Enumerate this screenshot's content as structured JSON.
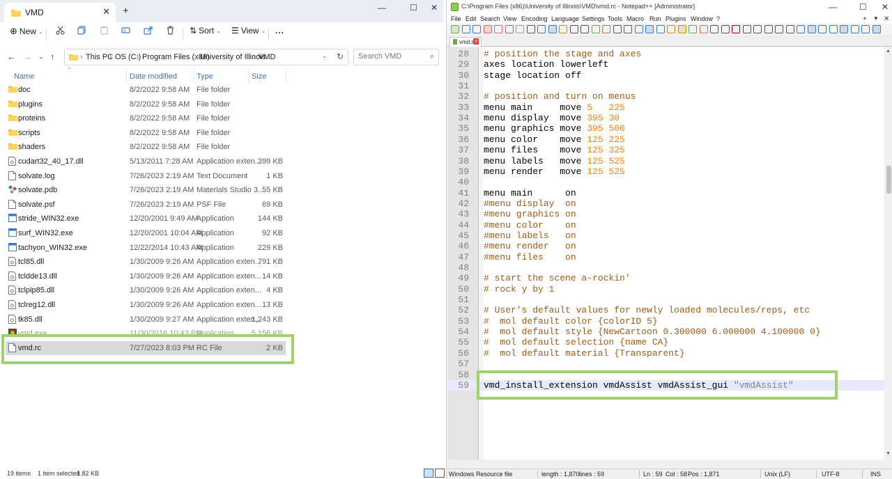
{
  "explorer": {
    "tab_title": "VMD",
    "new_tab": "+",
    "window_controls": {
      "minimize": "—",
      "maximize": "☐",
      "close": "✕"
    },
    "toolbar": {
      "new_label": "New",
      "sort_label": "Sort",
      "view_label": "View",
      "more_label": "..."
    },
    "breadcrumbs": [
      "This PC",
      "OS (C:)",
      "Program Files (x86)",
      "University of Illinois",
      "VMD"
    ],
    "search_placeholder": "Search VMD",
    "columns": {
      "name": "Name",
      "date": "Date modified",
      "type": "Type",
      "size": "Size"
    },
    "files": [
      {
        "name": "doc",
        "date": "8/2/2022 9:58 AM",
        "type": "File folder",
        "size": "",
        "icon": "folder-icon"
      },
      {
        "name": "plugins",
        "date": "8/2/2022 9:58 AM",
        "type": "File folder",
        "size": "",
        "icon": "folder-icon"
      },
      {
        "name": "proteins",
        "date": "8/2/2022 9:58 AM",
        "type": "File folder",
        "size": "",
        "icon": "folder-icon"
      },
      {
        "name": "scripts",
        "date": "8/2/2022 9:58 AM",
        "type": "File folder",
        "size": "",
        "icon": "folder-icon"
      },
      {
        "name": "shaders",
        "date": "8/2/2022 9:58 AM",
        "type": "File folder",
        "size": "",
        "icon": "folder-icon"
      },
      {
        "name": "cudart32_40_17.dll",
        "date": "5/13/2011 7:28 AM",
        "type": "Application exten...",
        "size": "399 KB",
        "icon": "dll-icon"
      },
      {
        "name": "solvate.log",
        "date": "7/26/2023 2:19 AM",
        "type": "Text Document",
        "size": "1 KB",
        "icon": "document-icon"
      },
      {
        "name": "solvate.pdb",
        "date": "7/26/2023 2:19 AM",
        "type": "Materials Studio 3...",
        "size": "55 KB",
        "icon": "pdb-icon"
      },
      {
        "name": "solvate.psf",
        "date": "7/26/2023 2:19 AM",
        "type": "PSF File",
        "size": "69 KB",
        "icon": "document-icon"
      },
      {
        "name": "stride_WIN32.exe",
        "date": "12/20/2001 9:49 AM",
        "type": "Application",
        "size": "144 KB",
        "icon": "application-icon"
      },
      {
        "name": "surf_WIN32.exe",
        "date": "12/20/2001 10:04 AM",
        "type": "Application",
        "size": "92 KB",
        "icon": "application-icon"
      },
      {
        "name": "tachyon_WIN32.exe",
        "date": "12/22/2014 10:43 AM",
        "type": "Application",
        "size": "229 KB",
        "icon": "application-icon"
      },
      {
        "name": "tcl85.dll",
        "date": "1/30/2009 9:26 AM",
        "type": "Application exten...",
        "size": "791 KB",
        "icon": "dll-icon"
      },
      {
        "name": "tcldde13.dll",
        "date": "1/30/2009 9:26 AM",
        "type": "Application exten...",
        "size": "14 KB",
        "icon": "dll-icon"
      },
      {
        "name": "tclpip85.dll",
        "date": "1/30/2009 9:26 AM",
        "type": "Application exten...",
        "size": "4 KB",
        "icon": "dll-icon"
      },
      {
        "name": "tclreg12.dll",
        "date": "1/30/2009 9:26 AM",
        "type": "Application exten...",
        "size": "13 KB",
        "icon": "dll-icon"
      },
      {
        "name": "tk85.dll",
        "date": "1/30/2009 9:27 AM",
        "type": "Application exten...",
        "size": "1,243 KB",
        "icon": "dll-icon"
      },
      {
        "name": "vmd.exe",
        "date": "11/30/2016 10:43 PM",
        "type": "Application",
        "size": "5,156 KB",
        "icon": "vmd-app-icon"
      },
      {
        "name": "vmd.rc",
        "date": "7/27/2023 8:03 PM",
        "type": "RC File",
        "size": "2 KB",
        "icon": "document-icon"
      }
    ],
    "status": {
      "items": "19 items",
      "selected": "1 item selected",
      "size": "1.82 KB"
    },
    "highlight_color": "#9ed36a",
    "selected_row_color": "#d9d9d9"
  },
  "notepadpp": {
    "title": "C:\\Program Files (x86)\\University of Illinois\\VMD\\vmd.rc - Notepad++ [Administrator]",
    "menu": [
      "File",
      "Edit",
      "Search",
      "View",
      "Encoding",
      "Language",
      "Settings",
      "Tools",
      "Macro",
      "Run",
      "Plugins",
      "Window",
      "?"
    ],
    "menu_end": [
      "+",
      "▼",
      "✕"
    ],
    "tab_label": "vmd.rc",
    "tab_close": "x",
    "lines": [
      {
        "n": "28",
        "parts": [
          {
            "t": "# position the stage and axes",
            "k": "c"
          }
        ]
      },
      {
        "n": "29",
        "parts": [
          {
            "t": "axes location lowerleft",
            "k": ""
          }
        ]
      },
      {
        "n": "30",
        "parts": [
          {
            "t": "stage location off",
            "k": ""
          }
        ]
      },
      {
        "n": "31",
        "parts": []
      },
      {
        "n": "32",
        "parts": [
          {
            "t": "# position and turn on menus",
            "k": "c"
          }
        ]
      },
      {
        "n": "33",
        "parts": [
          {
            "t": "menu main     move ",
            "k": ""
          },
          {
            "t": "5   225",
            "k": "n"
          }
        ]
      },
      {
        "n": "34",
        "parts": [
          {
            "t": "menu display  move ",
            "k": ""
          },
          {
            "t": "395 30",
            "k": "n"
          }
        ]
      },
      {
        "n": "35",
        "parts": [
          {
            "t": "menu graphics move ",
            "k": ""
          },
          {
            "t": "395 500",
            "k": "n"
          }
        ]
      },
      {
        "n": "36",
        "parts": [
          {
            "t": "menu color    move ",
            "k": ""
          },
          {
            "t": "125 225",
            "k": "n"
          }
        ]
      },
      {
        "n": "37",
        "parts": [
          {
            "t": "menu files    move ",
            "k": ""
          },
          {
            "t": "125 325",
            "k": "n"
          }
        ]
      },
      {
        "n": "38",
        "parts": [
          {
            "t": "menu labels   move ",
            "k": ""
          },
          {
            "t": "125 525",
            "k": "n"
          }
        ]
      },
      {
        "n": "39",
        "parts": [
          {
            "t": "menu render   move ",
            "k": ""
          },
          {
            "t": "125 525",
            "k": "n"
          }
        ]
      },
      {
        "n": "40",
        "parts": []
      },
      {
        "n": "41",
        "parts": [
          {
            "t": "menu main      on",
            "k": ""
          }
        ]
      },
      {
        "n": "42",
        "parts": [
          {
            "t": "#menu display  on",
            "k": "c"
          }
        ]
      },
      {
        "n": "43",
        "parts": [
          {
            "t": "#menu graphics on",
            "k": "c"
          }
        ]
      },
      {
        "n": "44",
        "parts": [
          {
            "t": "#menu color    on",
            "k": "c"
          }
        ]
      },
      {
        "n": "45",
        "parts": [
          {
            "t": "#menu labels   on",
            "k": "c"
          }
        ]
      },
      {
        "n": "46",
        "parts": [
          {
            "t": "#menu render   on",
            "k": "c"
          }
        ]
      },
      {
        "n": "47",
        "parts": [
          {
            "t": "#menu files    on",
            "k": "c"
          }
        ]
      },
      {
        "n": "48",
        "parts": []
      },
      {
        "n": "49",
        "parts": [
          {
            "t": "# start the scene a-rockin'",
            "k": "c"
          }
        ]
      },
      {
        "n": "50",
        "parts": [
          {
            "t": "# rock y by 1",
            "k": "c"
          }
        ]
      },
      {
        "n": "51",
        "parts": []
      },
      {
        "n": "52",
        "parts": [
          {
            "t": "# User's default values for newly loaded molecules/reps, etc",
            "k": "c"
          }
        ]
      },
      {
        "n": "53",
        "parts": [
          {
            "t": "#  mol default color {colorID 5}",
            "k": "c"
          }
        ]
      },
      {
        "n": "54",
        "parts": [
          {
            "t": "#  mol default style {NewCartoon 0.300000 6.000000 4.100000 0}",
            "k": "c"
          }
        ]
      },
      {
        "n": "55",
        "parts": [
          {
            "t": "#  mol default selection {name CA}",
            "k": "c"
          }
        ]
      },
      {
        "n": "56",
        "parts": [
          {
            "t": "#  mol default material {Transparent}",
            "k": "c"
          }
        ]
      },
      {
        "n": "57",
        "parts": []
      },
      {
        "n": "58",
        "parts": []
      },
      {
        "n": "59",
        "parts": [
          {
            "t": "vmd_install_extension vmdAssist vmdAssist_gui ",
            "k": ""
          },
          {
            "t": "\"vmdAssist\"",
            "k": "s"
          }
        ],
        "current": true
      }
    ],
    "status": {
      "file_type": "Windows Resource file",
      "length": "length : 1,870",
      "lines": "lines : 59",
      "ln": "Ln : 59",
      "col": "Col : 58",
      "pos": "Pos : 1,871",
      "eol": "Unix (LF)",
      "encoding": "UTF-8",
      "ins": "INS"
    },
    "colors": {
      "comment": "#a05a14",
      "number": "#ff8000",
      "string": "#808080",
      "current_line": "#e8e8ff"
    }
  }
}
